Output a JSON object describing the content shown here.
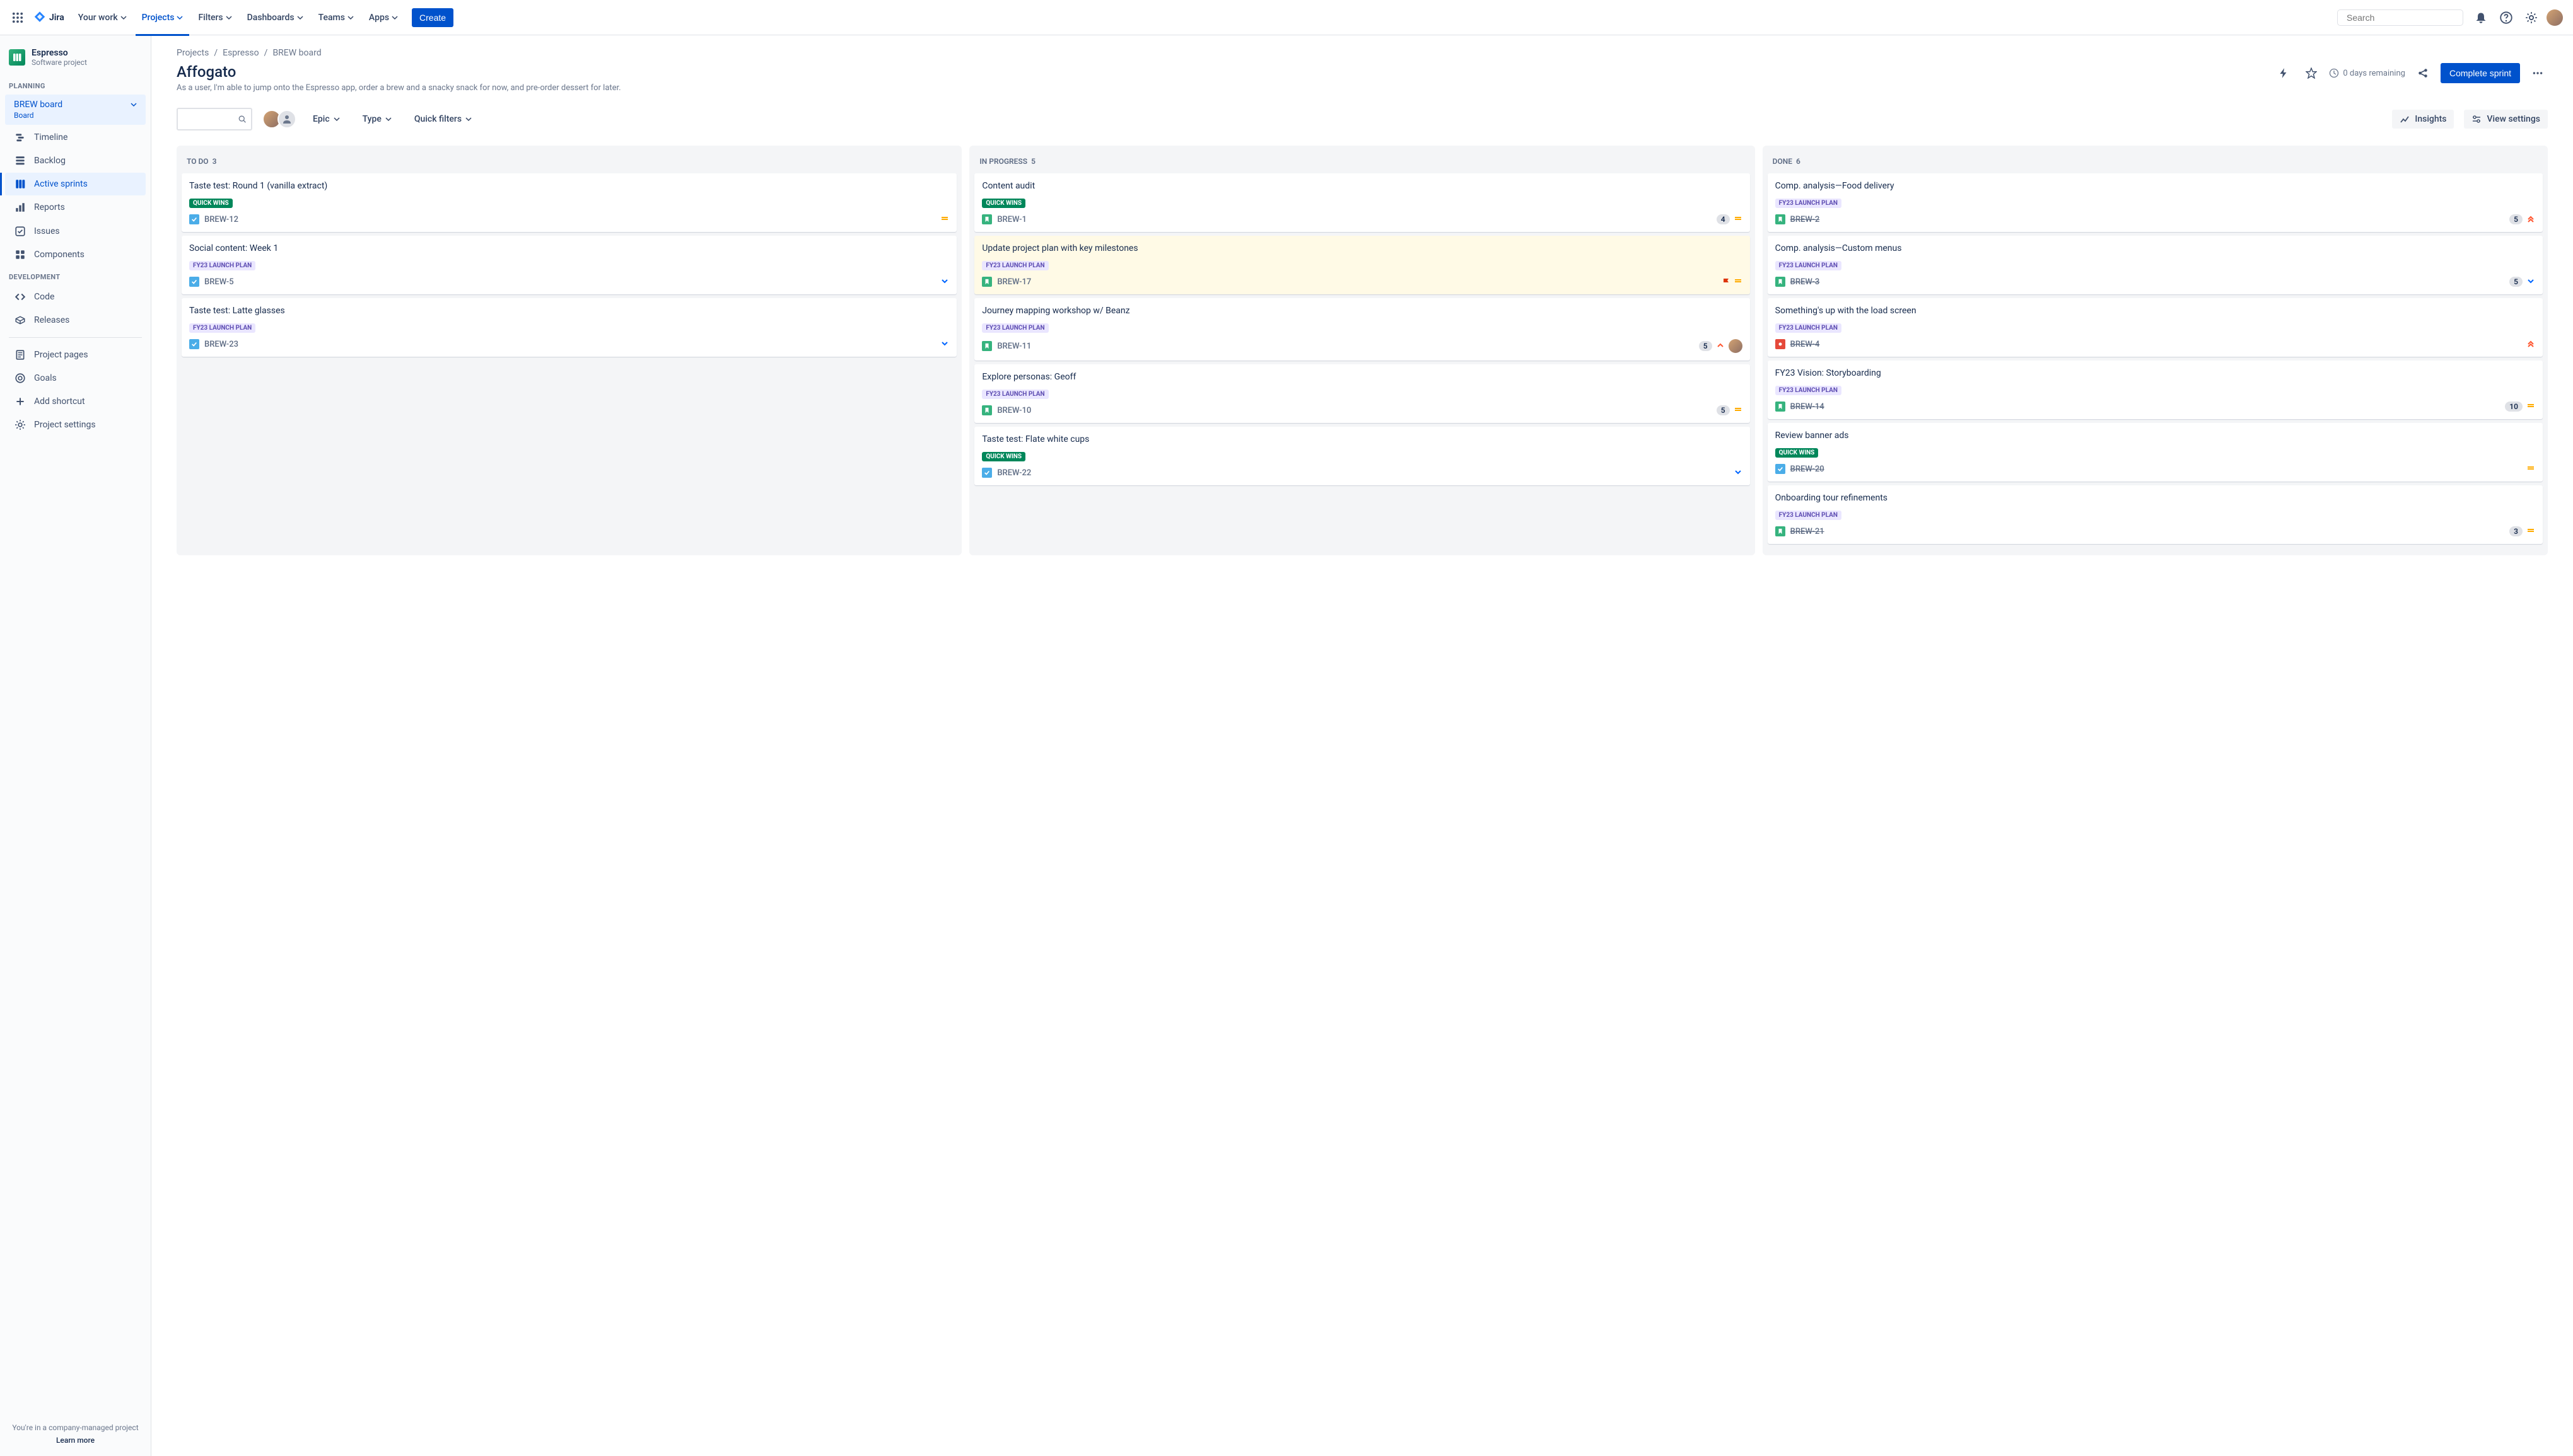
{
  "nav": {
    "logo_text": "Jira",
    "items": [
      "Your work",
      "Projects",
      "Filters",
      "Dashboards",
      "Teams",
      "Apps"
    ],
    "active_index": 1,
    "create_label": "Create",
    "search_placeholder": "Search"
  },
  "sidebar": {
    "project_name": "Espresso",
    "project_type": "Software project",
    "sections": {
      "planning_label": "PLANNING",
      "development_label": "DEVELOPMENT"
    },
    "brew_board": {
      "title": "BREW board",
      "subtitle": "Board"
    },
    "planning_items": [
      "Timeline",
      "Backlog",
      "Active sprints",
      "Reports"
    ],
    "planning_selected_index": 2,
    "flat_items": [
      "Issues",
      "Components"
    ],
    "dev_items": [
      "Code",
      "Releases"
    ],
    "bottom_items": [
      "Project pages",
      "Goals",
      "Add shortcut",
      "Project settings"
    ],
    "footer_text": "You're in a company-managed project",
    "footer_link": "Learn more"
  },
  "breadcrumb": [
    "Projects",
    "Espresso",
    "BREW board"
  ],
  "page": {
    "title": "Affogato",
    "description": "As a user, I'm able to jump onto the Espresso app, order a brew and a snacky snack for now, and pre-order dessert for later.",
    "days_remaining": "0 days remaining",
    "complete_label": "Complete sprint"
  },
  "filters": {
    "epic_label": "Epic",
    "type_label": "Type",
    "quick_filters_label": "Quick filters",
    "insights_label": "Insights",
    "view_settings_label": "View settings"
  },
  "labels": {
    "quick_wins": "QUICK WINS",
    "fy23": "FY23 LAUNCH PLAN"
  },
  "columns": [
    {
      "name": "TO DO",
      "count": "3",
      "cards": [
        {
          "title": "Taste test: Round 1 (vanilla extract)",
          "label": "quick_wins",
          "type": "task",
          "key": "BREW-12",
          "priority": "medium"
        },
        {
          "title": "Social content: Week 1",
          "label": "fy23",
          "type": "task",
          "key": "BREW-5",
          "priority": "low"
        },
        {
          "title": "Taste test: Latte glasses",
          "label": "fy23",
          "type": "task",
          "key": "BREW-23",
          "priority": "low"
        }
      ]
    },
    {
      "name": "IN PROGRESS",
      "count": "5",
      "cards": [
        {
          "title": "Content audit",
          "label": "quick_wins",
          "type": "story",
          "key": "BREW-1",
          "points": "4",
          "priority": "medium"
        },
        {
          "title": "Update project plan with key milestones",
          "label": "fy23",
          "type": "story",
          "key": "BREW-17",
          "flagged": true,
          "priority": "medium",
          "flag": true
        },
        {
          "title": "Journey mapping workshop w/ Beanz",
          "label": "fy23",
          "type": "story",
          "key": "BREW-11",
          "points": "5",
          "priority": "high",
          "avatar": true
        },
        {
          "title": "Explore personas: Geoff",
          "label": "fy23",
          "type": "story",
          "key": "BREW-10",
          "points": "5",
          "priority": "medium"
        },
        {
          "title": "Taste test: Flate white cups",
          "label": "quick_wins",
          "type": "task",
          "key": "BREW-22",
          "priority": "low"
        }
      ]
    },
    {
      "name": "DONE",
      "count": "6",
      "cards": [
        {
          "title": "Comp. analysis—Food delivery",
          "label": "fy23",
          "type": "story",
          "key": "BREW-2",
          "points": "5",
          "priority": "highest",
          "done": true
        },
        {
          "title": "Comp. analysis—Custom menus",
          "label": "fy23",
          "type": "story",
          "key": "BREW-3",
          "points": "5",
          "priority": "low",
          "done": true
        },
        {
          "title": "Something's up with the load screen",
          "label": "fy23",
          "type": "bug",
          "key": "BREW-4",
          "priority": "highest",
          "done": true
        },
        {
          "title": "FY23 Vision: Storyboarding",
          "label": "fy23",
          "type": "story",
          "key": "BREW-14",
          "points": "10",
          "priority": "medium",
          "done": true
        },
        {
          "title": "Review banner ads",
          "label": "quick_wins",
          "type": "task",
          "key": "BREW-20",
          "priority": "medium",
          "done": true
        },
        {
          "title": "Onboarding tour refinements",
          "label": "fy23",
          "type": "story",
          "key": "BREW-21",
          "points": "3",
          "priority": "medium",
          "done": true
        }
      ]
    }
  ]
}
